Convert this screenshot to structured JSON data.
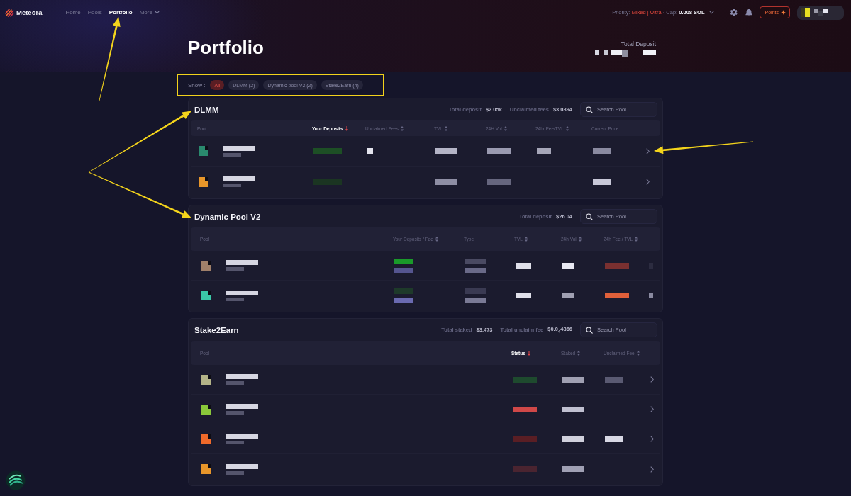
{
  "nav": {
    "brand": "Meteora",
    "items": [
      {
        "label": "Home",
        "kind": "link",
        "selected": false,
        "annotated": false
      },
      {
        "label": "Pools",
        "kind": "link",
        "selected": false,
        "annotated": false
      },
      {
        "label": "Portfolio",
        "kind": "link",
        "selected": true,
        "annotated": true
      },
      {
        "label": "More",
        "kind": "menu",
        "selected": false,
        "annotated": false
      }
    ]
  },
  "priority": {
    "label": "Priority:",
    "value": "Mixed | Ultra",
    "separator": "·",
    "cap_label": "Cap:",
    "cap_value": "0.008 SOL"
  },
  "points_button": {
    "label": "Points"
  },
  "page": {
    "title": "Portfolio",
    "total_deposit_label": "Total Deposit"
  },
  "filter": {
    "label": "Show :",
    "highlighted": true,
    "options": [
      {
        "label": "All",
        "selected": true
      },
      {
        "label": "DLMM (2)",
        "selected": false
      },
      {
        "label": "Dynamic pool V2 (2)",
        "selected": false
      },
      {
        "label": "Stake2Earn (4)",
        "selected": false
      }
    ]
  },
  "sections": [
    {
      "kind": "dlmm",
      "title": "DLMM",
      "annotated": true,
      "stats": [
        {
          "label": "Total deposit",
          "value": "$2.05k"
        },
        {
          "label": "Unclaimed fees",
          "value": "$3.0894"
        }
      ],
      "search": {
        "placeholder": "Search Pool"
      },
      "columns": [
        {
          "label": "Pool",
          "sortable": false,
          "selected": false
        },
        {
          "label": "Your Deposits",
          "sortable": true,
          "selected": true
        },
        {
          "label": "Unclaimed Fees",
          "sortable": true,
          "selected": false
        },
        {
          "label": "TVL",
          "sortable": true,
          "selected": false
        },
        {
          "label": "24H Vol",
          "sortable": true,
          "selected": false
        },
        {
          "label": "24hr Fee/TVL",
          "sortable": true,
          "selected": false
        },
        {
          "label": "Current Price",
          "sortable": false,
          "selected": false
        }
      ],
      "rows": [
        {
          "chevron": true,
          "annotated": true,
          "cells": [
            {
              "kind": "pool",
              "color": "#2a8a6e"
            },
            {
              "kind": "mosaic",
              "lines": [
                {
                  "color": "#1d4f25"
                }
              ]
            },
            {
              "kind": "mosaic",
              "lines": [
                {
                  "color": "#e4e4ee"
                }
              ]
            },
            {
              "kind": "mosaic",
              "lines": [
                {
                  "color": "#b4b4c6"
                }
              ]
            },
            {
              "kind": "mosaic",
              "lines": [
                {
                  "color": "#9a9ab0"
                }
              ]
            },
            {
              "kind": "mosaic",
              "lines": [
                {
                  "color": "#a6a6b8"
                }
              ]
            },
            {
              "kind": "mosaic",
              "lines": [
                {
                  "color": "#8a8aa0"
                }
              ]
            }
          ]
        },
        {
          "chevron": true,
          "annotated": false,
          "cells": [
            {
              "kind": "pool",
              "color": "#e8962a"
            },
            {
              "kind": "mosaic",
              "lines": [
                {
                  "color": "#1b3522"
                }
              ]
            },
            {
              "kind": "blank"
            },
            {
              "kind": "mosaic",
              "lines": [
                {
                  "color": "#8e8ea4"
                }
              ]
            },
            {
              "kind": "mosaic",
              "lines": [
                {
                  "color": "#66667e"
                }
              ]
            },
            {
              "kind": "blank"
            },
            {
              "kind": "mosaic",
              "lines": [
                {
                  "color": "#c8c8d8"
                }
              ]
            }
          ]
        }
      ]
    },
    {
      "kind": "dynamic",
      "title": "Dynamic Pool V2",
      "annotated": true,
      "stats": [
        {
          "label": "Total deposit",
          "value": "$26.04"
        }
      ],
      "search": {
        "placeholder": "Search Pool"
      },
      "columns": [
        {
          "label": "Pool",
          "sortable": false,
          "selected": false
        },
        {
          "label": "Your Deposits / Fee",
          "sortable": true,
          "selected": false
        },
        {
          "label": "Type",
          "sortable": false,
          "selected": false
        },
        {
          "label": "TVL",
          "sortable": true,
          "selected": false
        },
        {
          "label": "24h Vol",
          "sortable": true,
          "selected": false
        },
        {
          "label": "24h Fee / TVL",
          "sortable": true,
          "selected": false
        }
      ],
      "rows": [
        {
          "chevron": false,
          "annotated": false,
          "cells": [
            {
              "kind": "pool",
              "color": "#a0806a"
            },
            {
              "kind": "mosaic",
              "lines": [
                {
                  "color": "#1a9a2a"
                },
                {
                  "color": "#55558f"
                }
              ]
            },
            {
              "kind": "mosaic",
              "lines": [
                {
                  "color": "#4a4a62"
                },
                {
                  "color": "#6a6a88"
                }
              ]
            },
            {
              "kind": "mosaic",
              "lines": [
                {
                  "color": "#e0e0ea"
                }
              ]
            },
            {
              "kind": "mosaic",
              "lines": [
                {
                  "color": "#e8e8f2"
                }
              ]
            },
            {
              "kind": "mosaic",
              "lines": [
                {
                  "color": "#7a3030"
                }
              ]
            },
            {
              "kind": "mosaic",
              "lines": [
                {
                  "color": "#2c2c40"
                }
              ]
            }
          ]
        },
        {
          "chevron": false,
          "annotated": false,
          "cells": [
            {
              "kind": "pool",
              "color": "#3ac8a8"
            },
            {
              "kind": "mosaic",
              "lines": [
                {
                  "color": "#1e3a2a"
                },
                {
                  "color": "#6a6ab0"
                }
              ]
            },
            {
              "kind": "mosaic",
              "lines": [
                {
                  "color": "#3a3a52"
                },
                {
                  "color": "#7a7a95"
                }
              ]
            },
            {
              "kind": "mosaic",
              "lines": [
                {
                  "color": "#e0e0ea"
                }
              ]
            },
            {
              "kind": "mosaic",
              "lines": [
                {
                  "color": "#a0a0b2"
                }
              ]
            },
            {
              "kind": "mosaic",
              "lines": [
                {
                  "color": "#e0603a"
                }
              ]
            },
            {
              "kind": "mosaic",
              "lines": [
                {
                  "color": "#8a8aa0"
                }
              ]
            }
          ]
        }
      ]
    },
    {
      "kind": "stake",
      "title": "Stake2Earn",
      "annotated": false,
      "stats": [
        {
          "label": "Total staked",
          "value": "$3.473"
        },
        {
          "label": "Total unclaim fee",
          "value": "$0.0$_{4}$4866"
        }
      ],
      "search": {
        "placeholder": "Search Pool"
      },
      "columns": [
        {
          "label": "Pool",
          "sortable": false,
          "selected": false
        },
        {
          "label": "Status",
          "sortable": true,
          "selected": true
        },
        {
          "label": "Staked",
          "sortable": true,
          "selected": false
        },
        {
          "label": "Unclaimed Fee",
          "sortable": true,
          "selected": false
        }
      ],
      "rows": [
        {
          "chevron": true,
          "annotated": false,
          "cells": [
            {
              "kind": "pool",
              "color": "#b4b488"
            },
            {
              "kind": "mosaic",
              "lines": [
                {
                  "color": "#1e4a2e"
                }
              ]
            },
            {
              "kind": "mosaic",
              "lines": [
                {
                  "color": "#a0a0b2"
                }
              ]
            },
            {
              "kind": "mosaic",
              "lines": [
                {
                  "color": "#5a5a72"
                }
              ]
            }
          ]
        },
        {
          "chevron": true,
          "annotated": false,
          "cells": [
            {
              "kind": "pool",
              "color": "#8ac83a"
            },
            {
              "kind": "mosaic",
              "lines": [
                {
                  "color": "#d04848"
                }
              ]
            },
            {
              "kind": "mosaic",
              "lines": [
                {
                  "color": "#c0c0d0"
                }
              ]
            },
            {
              "kind": "blank"
            }
          ]
        },
        {
          "chevron": true,
          "annotated": false,
          "cells": [
            {
              "kind": "pool",
              "color": "#f06a2a"
            },
            {
              "kind": "mosaic",
              "lines": [
                {
                  "color": "#5a1e24"
                }
              ]
            },
            {
              "kind": "mosaic",
              "lines": [
                {
                  "color": "#d0d0dc"
                }
              ]
            },
            {
              "kind": "mosaic",
              "lines": [
                {
                  "color": "#d8d8e4"
                }
              ]
            }
          ]
        },
        {
          "chevron": true,
          "annotated": false,
          "cells": [
            {
              "kind": "pool",
              "color": "#e8962a"
            },
            {
              "kind": "mosaic",
              "lines": [
                {
                  "color": "#4a2430"
                }
              ]
            },
            {
              "kind": "mosaic",
              "lines": [
                {
                  "color": "#a0a0b4"
                }
              ]
            },
            {
              "kind": "blank"
            }
          ]
        }
      ]
    }
  ]
}
